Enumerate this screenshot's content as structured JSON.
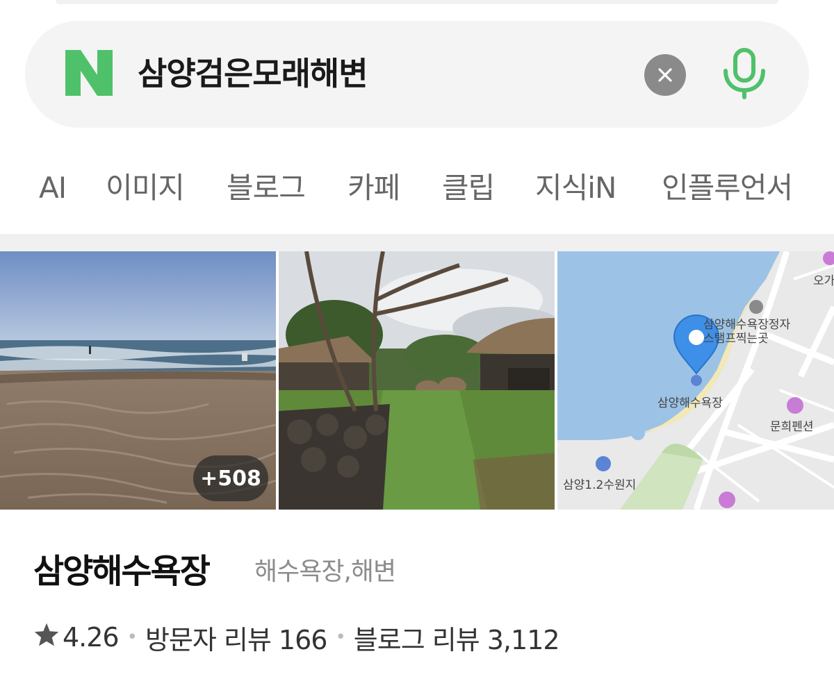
{
  "search": {
    "query": "삼양검은모래해변"
  },
  "tabs": [
    "AI",
    "이미지",
    "블로그",
    "카페",
    "클립",
    "지식iN",
    "인플루언서"
  ],
  "gallery": {
    "photo_count_badge": "+508",
    "map_labels": {
      "stamp_spot": "삼양해수욕장정자\n스탬프찍는곳",
      "beach": "삼양해수욕장",
      "pension": "문희펜션",
      "reservoir": "삼양1.2수원지",
      "top_right": "오가"
    }
  },
  "place": {
    "name": "삼양해수욕장",
    "category": "해수욕장,해변",
    "rating": "4.26",
    "visitor_reviews": "방문자 리뷰 166",
    "blog_reviews": "블로그 리뷰 3,112"
  },
  "colors": {
    "brand_green": "#03C75A",
    "map_water": "#9CC3E6",
    "map_pin": "#3D8FE8"
  },
  "icons": [
    "naver-logo-icon",
    "clear-icon",
    "microphone-icon",
    "star-icon",
    "map-pin-icon"
  ]
}
